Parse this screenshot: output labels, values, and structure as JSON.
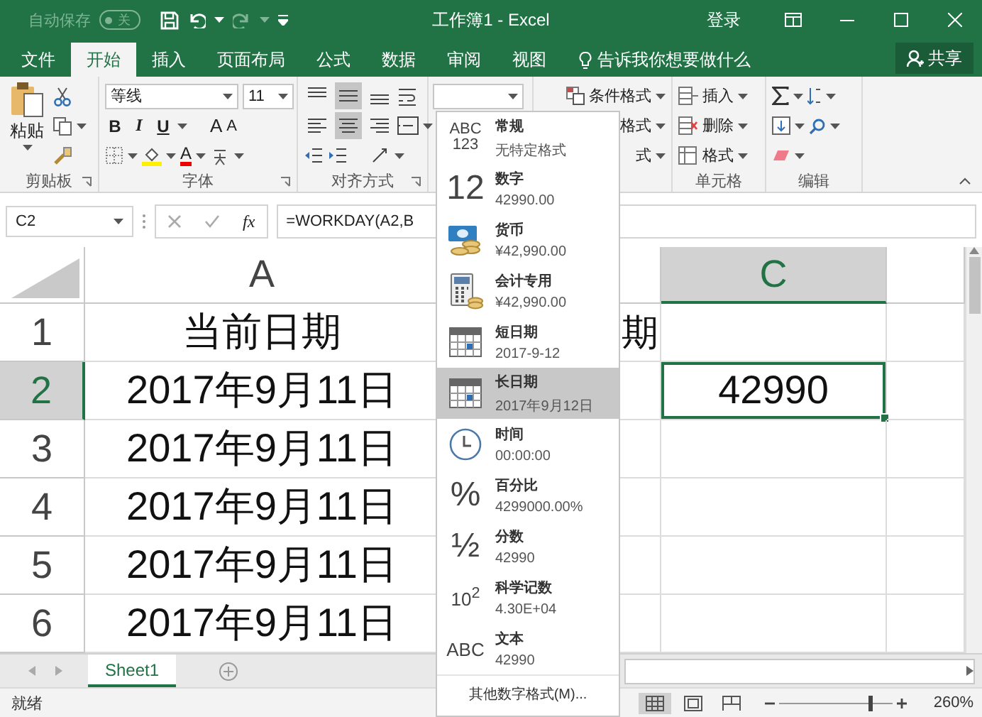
{
  "title_bar": {
    "autosave": {
      "label": "自动保存",
      "state": "关",
      "on": false
    },
    "title": "工作簿1 - Excel",
    "sign_in": "登录"
  },
  "ribbon_tabs": [
    {
      "label": "文件",
      "selected": false
    },
    {
      "label": "开始",
      "selected": true
    },
    {
      "label": "插入",
      "selected": false
    },
    {
      "label": "页面布局",
      "selected": false
    },
    {
      "label": "公式",
      "selected": false
    },
    {
      "label": "数据",
      "selected": false
    },
    {
      "label": "审阅",
      "selected": false
    },
    {
      "label": "视图",
      "selected": false
    }
  ],
  "tell_me": "告诉我你想要做什么",
  "share_button": "共享",
  "ribbon": {
    "clipboard": {
      "label": "剪贴板",
      "paste": "粘贴"
    },
    "font": {
      "label": "字体",
      "font_name": "等线",
      "font_size": "11",
      "bold": "B",
      "italic": "I",
      "underline": "U",
      "grow_font": "A",
      "shrink_font": "A",
      "font_color": "A"
    },
    "alignment": {
      "label": "对齐方式",
      "buttons": [
        {
          "kind": "top",
          "selected": false
        },
        {
          "kind": "middle",
          "selected": true
        },
        {
          "kind": "bottom",
          "selected": false
        },
        {
          "kind": "left",
          "selected": false
        },
        {
          "kind": "center",
          "selected": true
        },
        {
          "kind": "right",
          "selected": false
        }
      ]
    },
    "styles": {
      "conditional_formatting": "条件格式",
      "table_format": "格式",
      "cell_styles": "式"
    },
    "cells": {
      "label": "单元格",
      "insert": "插入",
      "delete": "删除",
      "format": "格式"
    },
    "editing": {
      "label": "编辑"
    }
  },
  "formula_bar": {
    "name_box": "C2",
    "function_button": "fx",
    "formula": "=WORKDAY(A2,B"
  },
  "grid": {
    "columns": [
      {
        "label": "A",
        "selected": false
      },
      {
        "selected": false
      },
      {
        "label": "C",
        "selected": true
      },
      {
        "selected": false
      }
    ],
    "rows": [
      {
        "number": "1",
        "selected": false,
        "a": "当前日期",
        "b": "期"
      },
      {
        "number": "2",
        "selected": true,
        "a": "2017年9月11日",
        "c": "42990"
      },
      {
        "number": "3",
        "selected": false,
        "a": "2017年9月11日"
      },
      {
        "number": "4",
        "selected": false,
        "a": "2017年9月11日"
      },
      {
        "number": "5",
        "selected": false,
        "a": "2017年9月11日"
      },
      {
        "number": "6",
        "selected": false,
        "a": "2017年9月11日"
      }
    ]
  },
  "format_menu": {
    "items": [
      {
        "kind": "general",
        "glyph": [
          "ABC",
          "123"
        ],
        "name": "常规",
        "example": "无特定格式",
        "selected": false
      },
      {
        "kind": "number",
        "glyph": [
          "12"
        ],
        "name": "数字",
        "example": "42990.00",
        "selected": false
      },
      {
        "kind": "currency",
        "name": "货币",
        "example": "¥42,990.00",
        "selected": false
      },
      {
        "kind": "accounting",
        "name": "会计专用",
        "example": "¥42,990.00",
        "selected": false
      },
      {
        "kind": "short_date",
        "name": "短日期",
        "example": "2017-9-12",
        "selected": false
      },
      {
        "kind": "long_date",
        "name": "长日期",
        "example": "2017年9月12日",
        "selected": true
      },
      {
        "kind": "time",
        "name": "时间",
        "example": "00:00:00",
        "selected": false
      },
      {
        "kind": "percent",
        "glyph": [
          "%"
        ],
        "name": "百分比",
        "example": "4299000.00%",
        "selected": false
      },
      {
        "kind": "fraction",
        "glyph": [
          "½"
        ],
        "name": "分数",
        "example": "42990",
        "selected": false
      },
      {
        "kind": "scientific",
        "glyph": [
          "10$^{2}$"
        ],
        "name": "科学记数",
        "example": "4.30E+04",
        "selected": false
      },
      {
        "kind": "text",
        "glyph": [
          "ABC"
        ],
        "name": "文本",
        "example": "42990",
        "selected": false
      }
    ],
    "more": "其他数字格式(M)..."
  },
  "sheet_tabs": [
    {
      "label": "Sheet1",
      "selected": true
    }
  ],
  "status_bar": {
    "status": "就绪",
    "views": [
      {
        "kind": "normal",
        "selected": true
      },
      {
        "kind": "page_layout",
        "selected": false
      },
      {
        "kind": "page_break",
        "selected": false
      }
    ],
    "zoom": {
      "level": 0.8,
      "reading": "260%"
    }
  }
}
